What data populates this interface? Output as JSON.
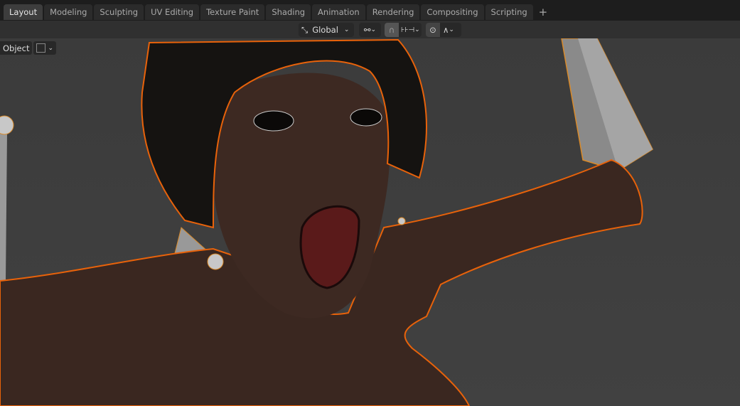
{
  "workspace_tabs": [
    {
      "label": "Layout",
      "active": true
    },
    {
      "label": "Modeling"
    },
    {
      "label": "Sculpting"
    },
    {
      "label": "UV Editing"
    },
    {
      "label": "Texture Paint"
    },
    {
      "label": "Shading"
    },
    {
      "label": "Animation"
    },
    {
      "label": "Rendering"
    },
    {
      "label": "Compositing"
    },
    {
      "label": "Scripting"
    }
  ],
  "add_tab_label": "+",
  "header": {
    "transform_orientation": "Global",
    "icons": [
      "transform-orientation-icon",
      "pivot-link-icon",
      "snap-magnet-icon",
      "snap-increment-icon",
      "proportional-edit-icon",
      "falloff-curve-icon"
    ]
  },
  "viewport": {
    "mode_label": "Object",
    "selection_outline_color": "#e8620a",
    "background": "#3d3d3d"
  }
}
